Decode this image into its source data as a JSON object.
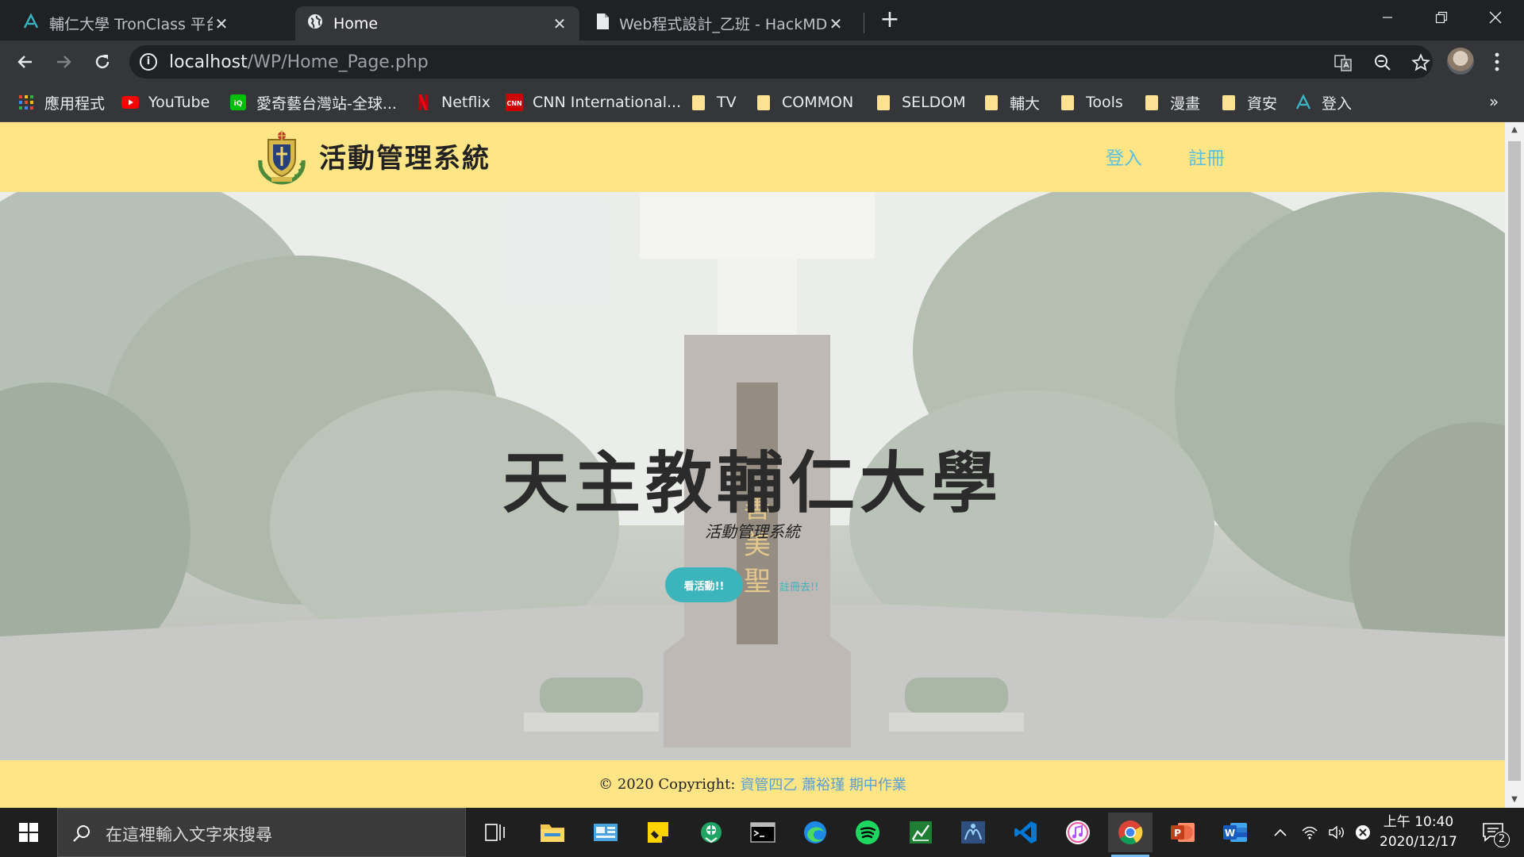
{
  "browser": {
    "tabs": [
      {
        "title": "輔仁大學 TronClass 平台",
        "icon": "tronclass-icon",
        "active": false
      },
      {
        "title": "Home",
        "icon": "globe-icon",
        "active": true
      },
      {
        "title": "Web程式設計_乙班 - HackMD",
        "icon": "document-icon",
        "active": false
      }
    ],
    "tab_close_glyph": "✕",
    "new_tab_glyph": "+",
    "window_controls": [
      "minimize",
      "restore",
      "close"
    ],
    "address": {
      "host": "localhost",
      "path": "/WP/Home_Page.php"
    },
    "toolbar_icons": [
      "back-icon",
      "forward-icon",
      "reload-icon",
      "info-icon",
      "translate-icon",
      "zoom-icon",
      "star-icon",
      "profile-avatar",
      "menu-icon"
    ],
    "bookmarks": [
      {
        "label": "應用程式",
        "icon": "apps-grid-icon"
      },
      {
        "label": "YouTube",
        "icon": "youtube-icon"
      },
      {
        "label": "愛奇藝台灣站-全球...",
        "icon": "iqiyi-icon"
      },
      {
        "label": "Netflix",
        "icon": "netflix-icon"
      },
      {
        "label": "CNN International...",
        "icon": "cnn-icon"
      },
      {
        "label": "TV",
        "icon": "folder-icon"
      },
      {
        "label": "COMMON",
        "icon": "folder-icon"
      },
      {
        "label": "SELDOM",
        "icon": "folder-icon"
      },
      {
        "label": "輔大",
        "icon": "folder-icon"
      },
      {
        "label": "Tools",
        "icon": "folder-icon"
      },
      {
        "label": "漫畫",
        "icon": "folder-icon"
      },
      {
        "label": "資安",
        "icon": "folder-icon"
      },
      {
        "label": "登入",
        "icon": "tronclass-icon"
      }
    ],
    "bookmarks_more": "»"
  },
  "page": {
    "header": {
      "title": "活動管理系統",
      "nav": [
        "登入",
        "註冊"
      ]
    },
    "hero": {
      "title": "天主教輔仁大學",
      "subtitle": "活動管理系統",
      "primary_button": "看活動!!",
      "secondary_link": "註冊去!!"
    },
    "footer": {
      "copyright": "© 2020 Copyright:",
      "author": "資管四乙 蕭裕瑾 期中作業"
    },
    "colors": {
      "header_bg": "#ffe585",
      "accent": "#3cb4bc",
      "nav_link": "#5bc0de"
    }
  },
  "taskbar": {
    "search_placeholder": "在這裡輸入文字來搜尋",
    "apps": [
      "task-view-icon",
      "file-explorer-icon",
      "control-panel-icon",
      "sticky-notes-icon",
      "maps-icon",
      "terminal-icon",
      "edge-icon",
      "spotify-icon",
      "charts-app-icon",
      "remote-app-icon",
      "vscode-icon",
      "itunes-icon",
      "chrome-icon",
      "powerpoint-icon",
      "word-icon"
    ],
    "active_app": "chrome-icon",
    "clock": {
      "time": "上午 10:40",
      "date": "2020/12/17"
    },
    "notifications_count": "2"
  }
}
